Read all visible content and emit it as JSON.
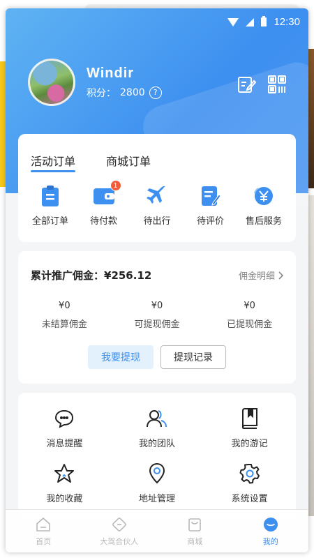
{
  "status_bar": {
    "time": "12:30"
  },
  "profile": {
    "username": "Windir",
    "points_label": "积分：",
    "points_value": "2800",
    "help_symbol": "?"
  },
  "orders": {
    "tabs": [
      {
        "label": "活动订单",
        "active": true
      },
      {
        "label": "商城订单",
        "active": false
      }
    ],
    "items": [
      {
        "label": "全部订单",
        "icon": "clipboard-icon"
      },
      {
        "label": "待付款",
        "icon": "wallet-icon",
        "badge": "1"
      },
      {
        "label": "待出行",
        "icon": "airplane-icon"
      },
      {
        "label": "待评价",
        "icon": "edit-document-icon"
      },
      {
        "label": "售后服务",
        "icon": "yuan-service-icon"
      }
    ]
  },
  "commission": {
    "title": "累计推广佣金：¥256.12",
    "detail_link": "佣金明细",
    "stats": [
      {
        "value": "¥0",
        "label": "未结算佣金"
      },
      {
        "value": "¥0",
        "label": "可提现佣金"
      },
      {
        "value": "¥0",
        "label": "已提现佣金"
      }
    ],
    "withdraw_button": "我要提现",
    "records_button": "提现记录"
  },
  "services": [
    {
      "label": "消息提醒",
      "icon": "message-icon"
    },
    {
      "label": "我的团队",
      "icon": "team-icon"
    },
    {
      "label": "我的游记",
      "icon": "travel-book-icon"
    },
    {
      "label": "我的收藏",
      "icon": "star-icon"
    },
    {
      "label": "地址管理",
      "icon": "location-icon"
    },
    {
      "label": "系统设置",
      "icon": "settings-icon"
    }
  ],
  "tabbar": [
    {
      "label": "首页",
      "icon": "home-icon",
      "active": false
    },
    {
      "label": "大驾合伙人",
      "icon": "partner-icon",
      "active": false
    },
    {
      "label": "商城",
      "icon": "shop-icon",
      "active": false
    },
    {
      "label": "我的",
      "icon": "profile-icon",
      "active": true
    }
  ],
  "colors": {
    "primary": "#3d8ff0",
    "badge": "#f25a3a",
    "header_gradient_start": "#5fb3f3",
    "header_gradient_end": "#3d8ff0"
  }
}
